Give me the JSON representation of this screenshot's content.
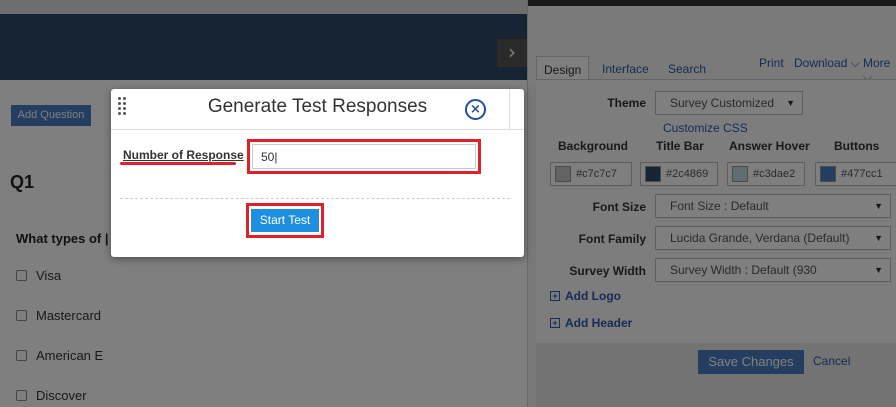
{
  "left": {
    "add_question": "Add Question",
    "question_number": "Q1",
    "question_text": "What types of |",
    "options": [
      "Visa",
      "Mastercard",
      "American E",
      "Discover"
    ]
  },
  "right": {
    "tabs": [
      "Design",
      "Interface",
      "Search"
    ],
    "links": {
      "print": "Print",
      "download": "Download ⌵",
      "more": "More ⌵"
    },
    "theme_label": "Theme",
    "theme_value": "Survey Customized",
    "customize_css": "Customize CSS",
    "color_headers": [
      "Background",
      "Title Bar",
      "Answer Hover",
      "Buttons"
    ],
    "colors": [
      {
        "hex": "#c7c7c7",
        "label": "#c7c7c7"
      },
      {
        "hex": "#2c4869",
        "label": "#2c4869"
      },
      {
        "hex": "#c3dae2",
        "label": "#c3dae2"
      },
      {
        "hex": "#477cc1",
        "label": "#477cc1"
      }
    ],
    "font_size_label": "Font Size",
    "font_size_value": "Font Size : Default",
    "font_family_label": "Font Family",
    "font_family_value": "Lucida Grande, Verdana (Default)",
    "survey_width_label": "Survey Width",
    "survey_width_value": "Survey Width : Default (930",
    "add_logo": "Add Logo",
    "add_header": "Add Header",
    "save_changes": "Save Changes",
    "cancel": "Cancel"
  },
  "modal": {
    "title": "Generate Test Responses",
    "close_symbol": "×",
    "number_label": "Number of Response",
    "number_value": "50|",
    "start_button": "Start Test"
  }
}
